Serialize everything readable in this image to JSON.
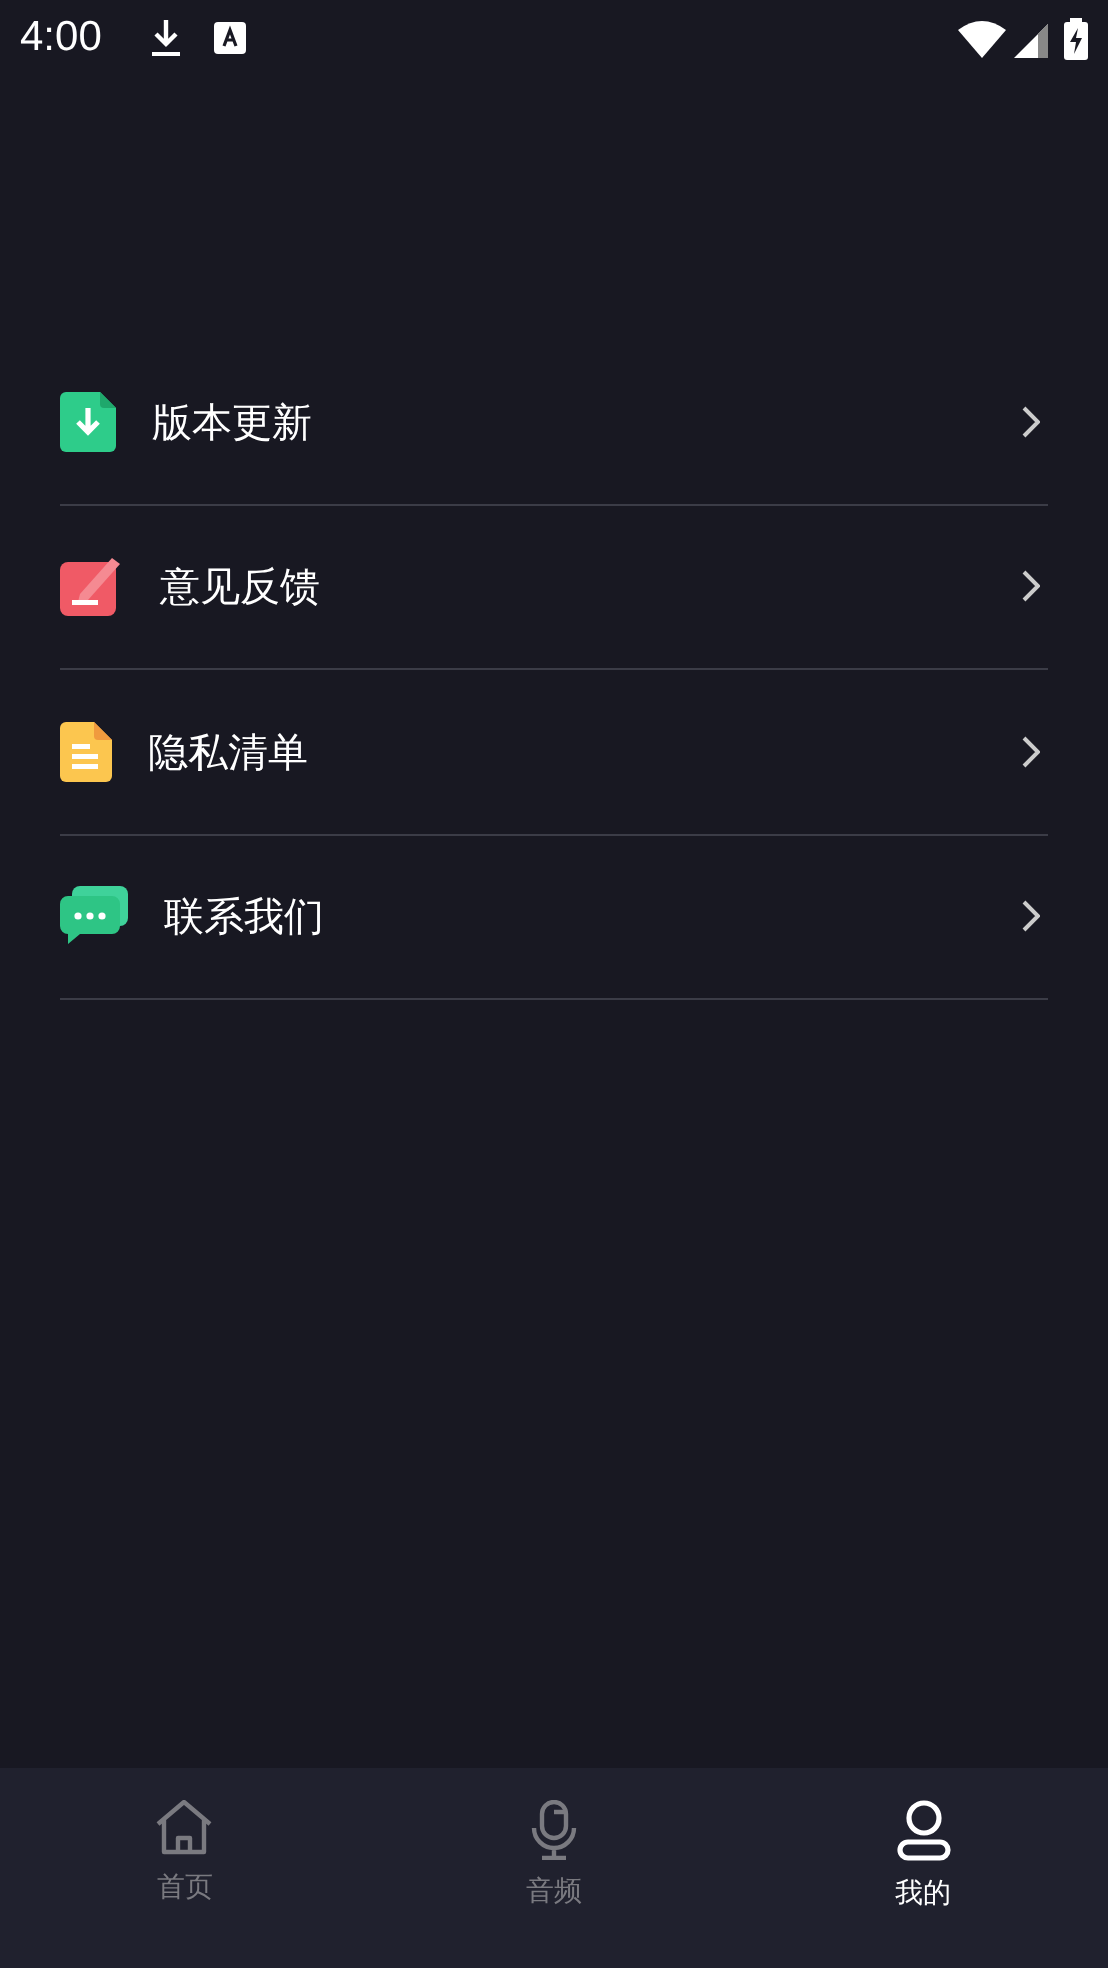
{
  "status_bar": {
    "time": "4:00"
  },
  "menu": [
    {
      "kind": "update",
      "label": "版本更新"
    },
    {
      "kind": "feedback",
      "label": "意见反馈"
    },
    {
      "kind": "privacy",
      "label": "隐私清单"
    },
    {
      "kind": "contact",
      "label": "联系我们"
    }
  ],
  "tabs": [
    {
      "kind": "home",
      "label": "首页",
      "selected": false
    },
    {
      "kind": "audio",
      "label": "音频",
      "selected": false
    },
    {
      "kind": "mine",
      "label": "我的",
      "selected": true
    }
  ]
}
